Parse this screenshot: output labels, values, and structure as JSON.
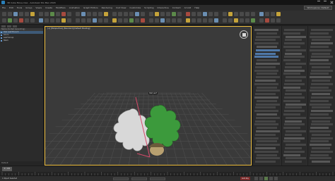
{
  "window": {
    "title": "3D Cube Move.max - Autodesk 3ds Max 2018"
  },
  "menubar": {
    "items": [
      "File",
      "Edit",
      "Tools",
      "Group",
      "Views",
      "Create",
      "Modifiers",
      "Animation",
      "Graph Editors",
      "Rendering",
      "Civil View",
      "Customize",
      "Scripting",
      "Interactive",
      "Content",
      "Arnold",
      "Help"
    ],
    "workspace_label": "Workspaces: Default"
  },
  "explorer": {
    "header": "Name (Sorted Ascending)",
    "items": [
      {
        "label": "Oak Leaf Branch",
        "selected": true
      },
      {
        "label": "Acorn",
        "selected": false
      },
      {
        "label": "Leaf Group",
        "selected": false
      },
      {
        "label": "Stem",
        "selected": false
      }
    ],
    "footer": "Default"
  },
  "viewport": {
    "label": "[+] [Perspective] [Standard] [Default Shading]",
    "object_label": "Oak Leaf"
  },
  "timeline": {
    "frame_label": "0 / 100"
  },
  "statusbar": {
    "selection_text": "1 Object Selected",
    "key_button": "Auto Key"
  },
  "colors": {
    "viewport_border": "#f0c040",
    "accent": "#4f78a8",
    "leaf_green": "#3c9a3c",
    "leaf_white": "#d8d8d8",
    "selection_line": "#d64a6a"
  }
}
